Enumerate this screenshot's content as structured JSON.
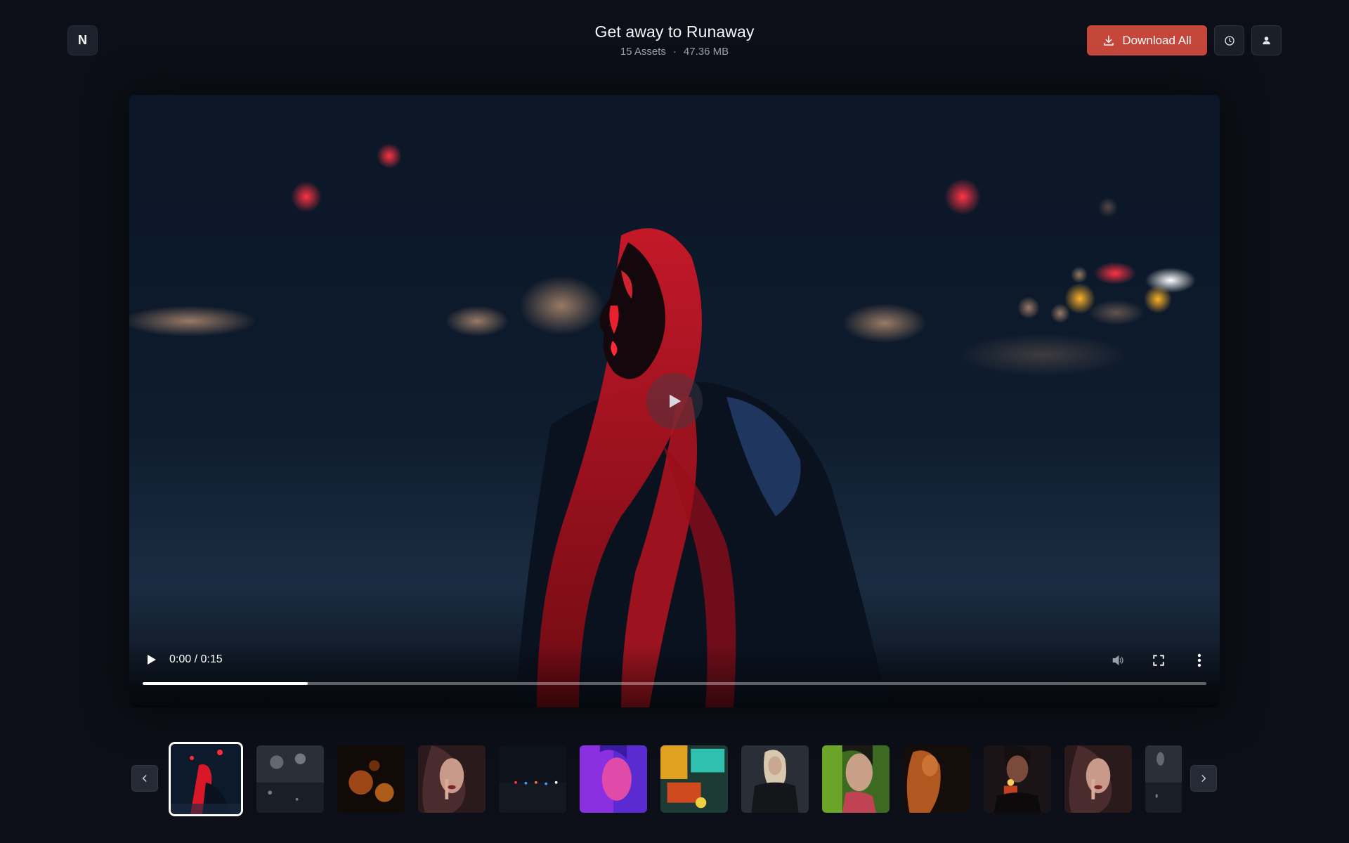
{
  "app": {
    "logo_letter": "N",
    "title": "Get away to Runaway",
    "asset_count": "15 Assets",
    "separator": "·",
    "total_size": "47.36 MB"
  },
  "toolbar": {
    "download_label": "Download All",
    "history_icon": "clock-icon",
    "user_icon": "user-icon"
  },
  "colors": {
    "background": "#0c0f17",
    "accent": "#c5473b",
    "surface": "#1b1f28"
  },
  "player": {
    "time_display": "0:00 / 0:15",
    "progress": 0.155,
    "icons": [
      "play-icon",
      "volume-icon",
      "fullscreen-icon",
      "more-vertical-icon"
    ]
  },
  "thumbnails": {
    "prev_icon": "chevron-left-icon",
    "next_icon": "chevron-right-icon",
    "selected_index": 0,
    "items": [
      {
        "scene": "neon-red-portrait"
      },
      {
        "scene": "rainy-window-lights"
      },
      {
        "scene": "orange-bokeh"
      },
      {
        "scene": "woman-finger-lips"
      },
      {
        "scene": "night-skyline"
      },
      {
        "scene": "purple-neon-face"
      },
      {
        "scene": "colorful-signs"
      },
      {
        "scene": "blonde-leather-jacket"
      },
      {
        "scene": "green-neon-profile"
      },
      {
        "scene": "orange-hair-dark"
      },
      {
        "scene": "man-lighting-cigarette"
      },
      {
        "scene": "woman-finger-lips-2"
      },
      {
        "scene": "rainy-window-partial"
      }
    ]
  }
}
